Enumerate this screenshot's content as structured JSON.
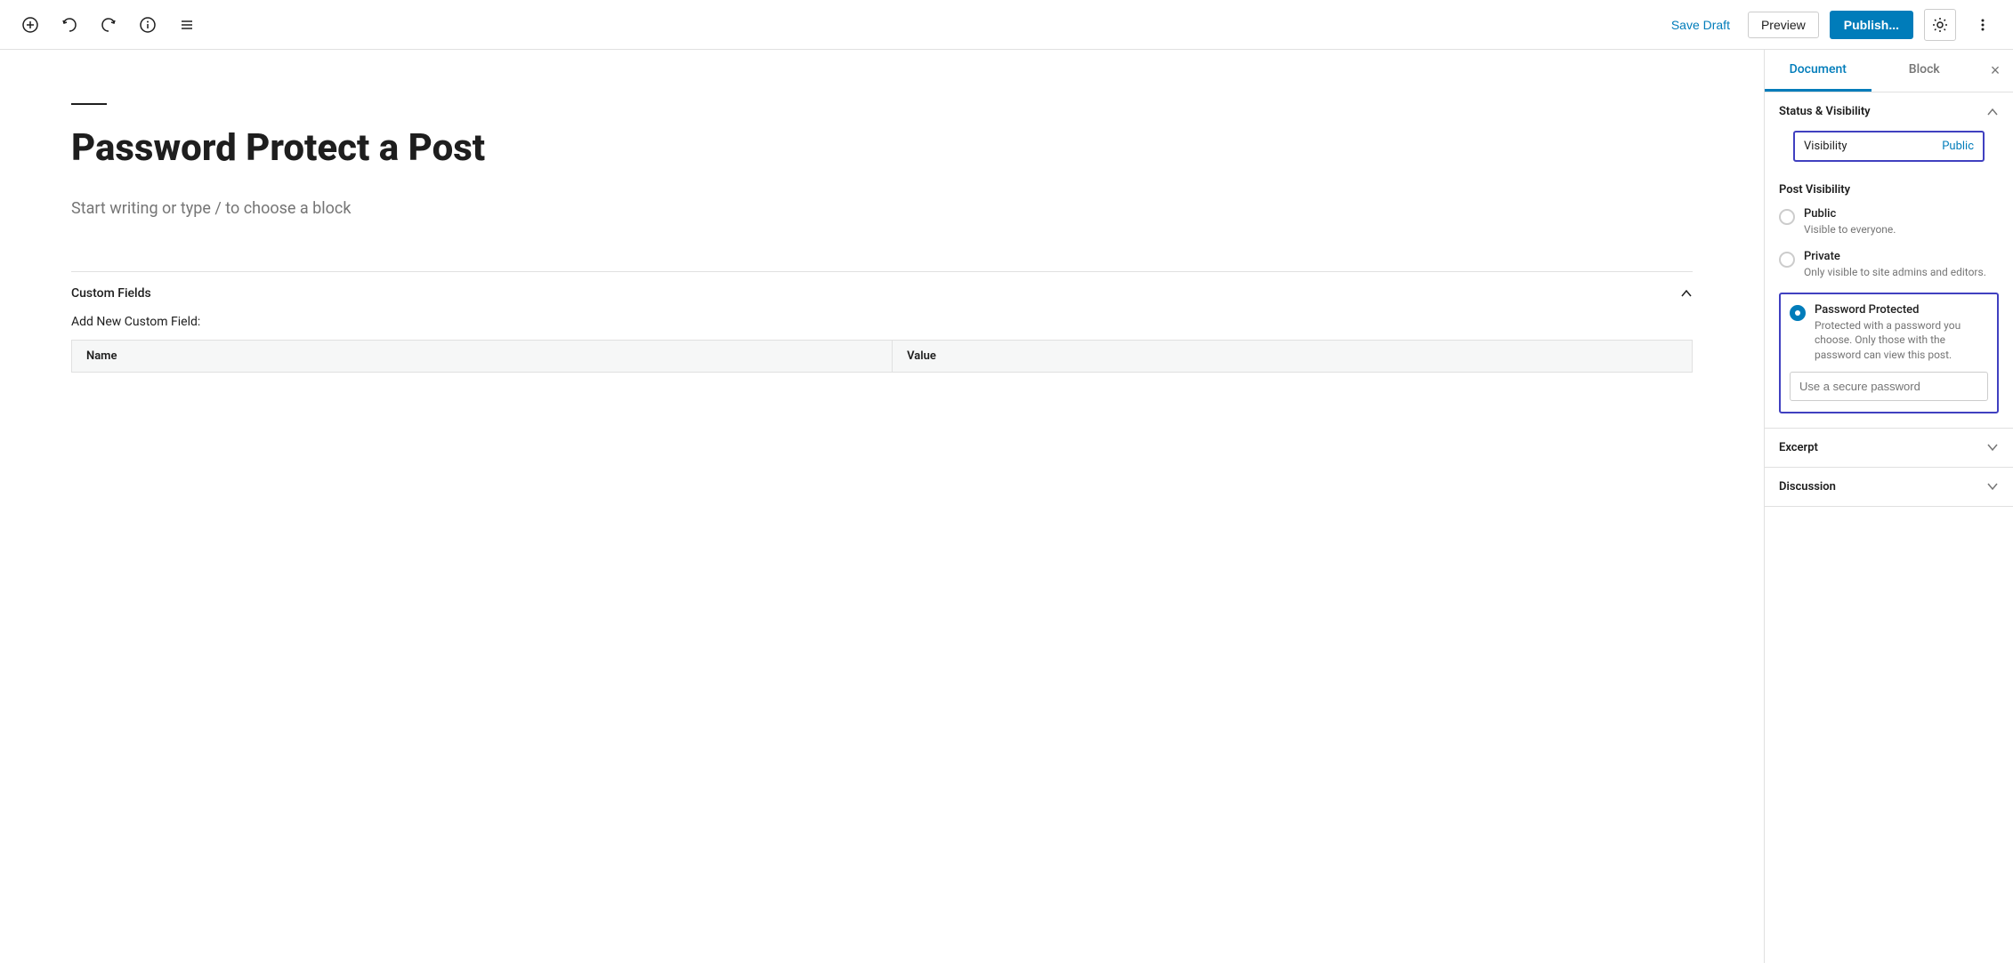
{
  "toolbar": {
    "save_draft_label": "Save Draft",
    "preview_label": "Preview",
    "publish_label": "Publish...",
    "icons": {
      "add": "+",
      "undo": "↩",
      "redo": "↪",
      "info": "ℹ",
      "menu": "≡",
      "settings_gear": "⚙",
      "more": "⋮"
    }
  },
  "editor": {
    "divider": "",
    "post_title": "Password Protect a Post",
    "placeholder": "Start writing or type / to choose a block",
    "custom_fields": {
      "label": "Custom Fields",
      "add_new_label": "Add New Custom Field:",
      "columns": [
        "Name",
        "Value"
      ]
    }
  },
  "sidebar": {
    "tabs": [
      {
        "id": "document",
        "label": "Document",
        "active": true
      },
      {
        "id": "block",
        "label": "Block",
        "active": false
      }
    ],
    "close_label": "×",
    "status_visibility": {
      "section_title": "Status & Visibility",
      "visibility_label": "Visibility",
      "visibility_value": "Public",
      "post_visibility_title": "Post Visibility",
      "options": [
        {
          "id": "public",
          "title": "Public",
          "description": "Visible to everyone.",
          "checked": false
        },
        {
          "id": "private",
          "title": "Private",
          "description": "Only visible to site admins and editors.",
          "checked": false
        },
        {
          "id": "password",
          "title": "Password Protected",
          "description": "Protected with a password you choose. Only those with the password can view this post.",
          "checked": true
        }
      ],
      "password_placeholder": "Use a secure password"
    },
    "excerpt": {
      "title": "Excerpt"
    },
    "discussion": {
      "title": "Discussion"
    }
  }
}
